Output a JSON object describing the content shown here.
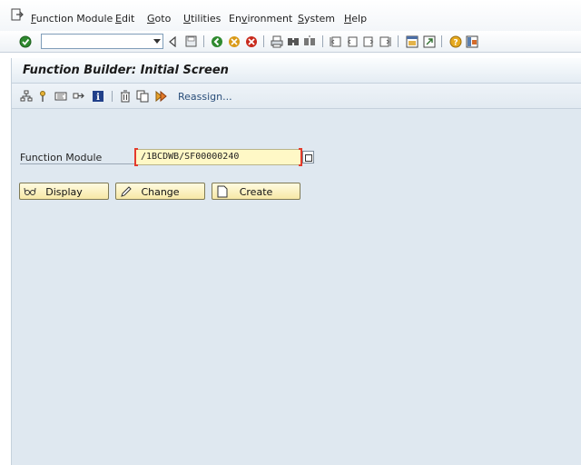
{
  "menu": {
    "items": [
      {
        "pre": "",
        "ul": "F",
        "post": "unction Module"
      },
      {
        "pre": "",
        "ul": "E",
        "post": "dit"
      },
      {
        "pre": "",
        "ul": "G",
        "post": "oto"
      },
      {
        "pre": "",
        "ul": "U",
        "post": "tilities"
      },
      {
        "pre": "En",
        "ul": "v",
        "post": "ironment"
      },
      {
        "pre": "",
        "ul": "S",
        "post": "ystem"
      },
      {
        "pre": "",
        "ul": "H",
        "post": "elp"
      }
    ]
  },
  "system_toolbar": {
    "command_field_value": "",
    "icons": [
      "enter-icon",
      "back-icon",
      "save-icon",
      "green-back-icon",
      "exit-icon",
      "cancel-icon",
      "print-icon",
      "find-icon",
      "find-next-icon",
      "first-page-icon",
      "previous-page-icon",
      "next-page-icon",
      "last-page-icon",
      "create-session-icon",
      "shortcut-icon",
      "help-icon",
      "customize-layout-icon"
    ]
  },
  "title_bar": {
    "title": "Function Builder: Initial Screen"
  },
  "app_toolbar": {
    "icons": [
      "object-list-icon",
      "where-used-icon",
      "display-object-icon",
      "other-object-icon",
      "info-icon",
      "delete-icon",
      "copy-icon",
      "rename-icon"
    ],
    "reassign_label": "Reassign..."
  },
  "form": {
    "function_module_label": "Function Module",
    "function_module_value": "/1BCDWB/SF00000240"
  },
  "buttons": {
    "display_label": "Display",
    "change_label": "Change",
    "create_label": "Create"
  },
  "colors": {
    "app_background": "#dfe8f0",
    "input_background": "#fff8c6",
    "required_marker": "#e33b2c",
    "button_background": "#f7e8a6"
  }
}
